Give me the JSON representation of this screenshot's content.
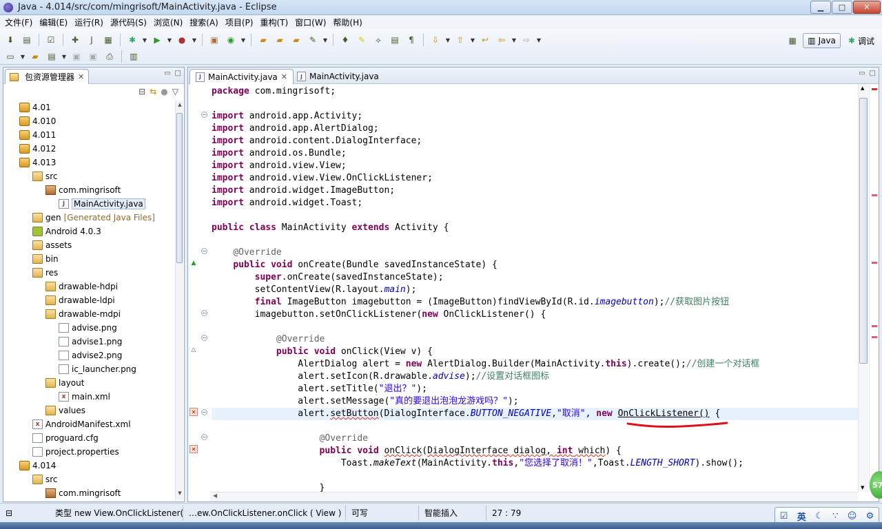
{
  "window": {
    "title": "Java  - 4.014/src/com/mingrisoft/MainActivity.java  - Eclipse",
    "min": "▁",
    "max": "□",
    "close": "✕"
  },
  "menu": [
    "文件(F)",
    "编辑(E)",
    "运行(R)",
    "源代码(S)",
    "浏览(N)",
    "搜索(A)",
    "项目(P)",
    "重构(T)",
    "窗口(W)",
    "帮助(H)"
  ],
  "perspectives": {
    "java": "Java",
    "debug": "调试"
  },
  "package_explorer": {
    "title": "包资源管理器",
    "tree": [
      {
        "label": "4.01",
        "icon": "project",
        "indent": 1
      },
      {
        "label": "4.010",
        "icon": "project",
        "indent": 1
      },
      {
        "label": "4.011",
        "icon": "project",
        "indent": 1
      },
      {
        "label": "4.012",
        "icon": "project",
        "indent": 1
      },
      {
        "label": "4.013",
        "icon": "project",
        "indent": 1
      },
      {
        "label": "src",
        "icon": "folder",
        "indent": 2
      },
      {
        "label": "com.mingrisoft",
        "icon": "package",
        "indent": 3
      },
      {
        "label": "MainActivity.java",
        "icon": "jfile",
        "indent": 4,
        "selected": true
      },
      {
        "label": "gen",
        "suffix": "[Generated Java Files]",
        "icon": "folder",
        "indent": 2
      },
      {
        "label": "Android 4.0.3",
        "icon": "android",
        "indent": 2
      },
      {
        "label": "assets",
        "icon": "folder",
        "indent": 2
      },
      {
        "label": "bin",
        "icon": "folder",
        "indent": 2
      },
      {
        "label": "res",
        "icon": "folder",
        "indent": 2
      },
      {
        "label": "drawable-hdpi",
        "icon": "folder",
        "indent": 3
      },
      {
        "label": "drawable-ldpi",
        "icon": "folder",
        "indent": 3
      },
      {
        "label": "drawable-mdpi",
        "icon": "folder",
        "indent": 3
      },
      {
        "label": "advise.png",
        "icon": "file",
        "indent": 4
      },
      {
        "label": "advise1.png",
        "icon": "file",
        "indent": 4
      },
      {
        "label": "advise2.png",
        "icon": "file",
        "indent": 4
      },
      {
        "label": "ic_launcher.png",
        "icon": "file",
        "indent": 4
      },
      {
        "label": "layout",
        "icon": "folder",
        "indent": 3
      },
      {
        "label": "main.xml",
        "icon": "xfile",
        "indent": 4
      },
      {
        "label": "values",
        "icon": "folder",
        "indent": 3
      },
      {
        "label": "AndroidManifest.xml",
        "icon": "xfile",
        "indent": 2
      },
      {
        "label": "proguard.cfg",
        "icon": "file",
        "indent": 2
      },
      {
        "label": "project.properties",
        "icon": "file",
        "indent": 2
      },
      {
        "label": "4.014",
        "icon": "project",
        "indent": 1
      },
      {
        "label": "src",
        "icon": "folder",
        "indent": 2
      },
      {
        "label": "com.mingrisoft",
        "icon": "package",
        "indent": 3
      }
    ]
  },
  "editor": {
    "tabs": [
      {
        "label": "MainActivity.java",
        "active": true
      },
      {
        "label": "MainActivity.java",
        "active": false
      }
    ],
    "lines": [
      "<span class='kw'>package</span> com.mingrisoft;",
      "",
      "<span class='kw'>import</span> android.app.Activity;",
      "<span class='kw'>import</span> android.app.AlertDialog;",
      "<span class='kw'>import</span> android.content.DialogInterface;",
      "<span class='kw'>import</span> android.os.Bundle;",
      "<span class='kw'>import</span> android.view.View;",
      "<span class='kw'>import</span> android.view.View.OnClickListener;",
      "<span class='kw'>import</span> android.widget.ImageButton;",
      "<span class='kw'>import</span> android.widget.Toast;",
      "",
      "<span class='kw'>public class</span> MainActivity <span class='kw'>extends</span> Activity {",
      "",
      "    <span class='ann'>@Override</span>",
      "    <span class='kw'>public void</span> onCreate(Bundle savedInstanceState) {",
      "        <span class='kw'>super</span>.onCreate(savedInstanceState);",
      "        setContentView(R.layout.<span class='fld'>main</span>);",
      "        <span class='kw'>final</span> ImageButton imagebutton = (ImageButton)findViewById(R.id.<span class='fld'>imagebutton</span>);<span class='cm'>//获取图片按钮</span>",
      "        imagebutton.setOnClickListener(<span class='kw'>new</span> OnClickListener() {",
      "",
      "            <span class='ann'>@Override</span>",
      "            <span class='kw'>public void</span> onClick(View v) {",
      "                AlertDialog alert = <span class='kw'>new</span> AlertDialog.Builder(MainActivity.<span class='kw'>this</span>).create();<span class='cm'>//创建一个对话框</span>",
      "                alert.setIcon(R.drawable.<span class='fld'>advise</span>);<span class='cm'>//设置对话框图标</span>",
      "                alert.setTitle(<span class='str'>\"退出？\"</span>);",
      "                alert.setMessage(<span class='str'>\"真的要退出泡泡龙游戏吗？\"</span>);",
      "                alert.<span class='squig'>setButton</span>(DialogInterface.<span class='fld'>BUTTON_NEGATIVE</span>,<span class='str'>\"取消\"</span>, <span class='kw'>new</span> <span class='ul'>OnClickListener()</span> {",
      "",
      "                    <span class='ann'>@Override</span>",
      "                    <span class='kw'>public void</span> <span class='squig'>onClick</span>(<span class='squig'>DialogInterface dialog, <span class='kw'>int</span> which</span>) {",
      "                        Toast.<span class='it' style='color:#000'>makeText</span>(MainActivity.<span class='kw'>this</span>,<span class='str'>\"您选择了取消！\"</span>,Toast.<span class='fld'>LENGTH_SHORT</span>).show();",
      "",
      "                    }"
    ]
  },
  "status": {
    "type_info": "类型 new View.OnClickListener(){}",
    "context": "…ew.OnClickListener.onClick ( View )",
    "writable": "可写",
    "insert_mode": "智能插入",
    "position": "27 : 79"
  },
  "ime": {
    "lang": "英"
  },
  "badge": "57"
}
